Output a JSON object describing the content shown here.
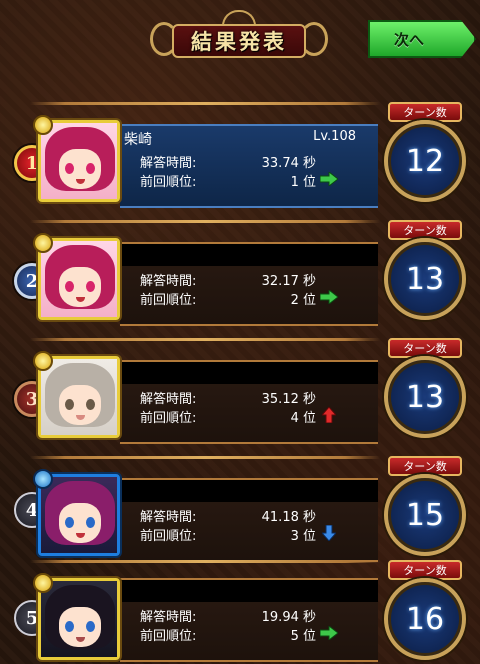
{
  "header": {
    "title": "結果発表",
    "next_label": "次へ"
  },
  "colors": {
    "arrow_up": "#e02a2a",
    "arrow_same": "#3ec84a",
    "arrow_down": "#3a8ae8",
    "highlight_panel": "#1a3a6a",
    "turn_circle": "#0a1a3e"
  },
  "labels": {
    "time": "解答時間:",
    "prev_rank": "前回順位:",
    "turn_count": "ターン数"
  },
  "results": [
    {
      "rank": "1",
      "name": "柴崎",
      "level": "Lv.108",
      "time": "33.74 秒",
      "prev_rank": "1 位",
      "trend": "same",
      "turns": "12",
      "avatar": "pink-hair-girl-avatar"
    },
    {
      "rank": "2",
      "name": "",
      "level": "",
      "time": "32.17 秒",
      "prev_rank": "2 位",
      "trend": "same",
      "turns": "13",
      "avatar": "pink-hair-girl-avatar"
    },
    {
      "rank": "3",
      "name": "",
      "level": "",
      "time": "35.12 秒",
      "prev_rank": "4 位",
      "trend": "up",
      "turns": "13",
      "avatar": "silver-hair-girl-avatar"
    },
    {
      "rank": "4",
      "name": "",
      "level": "",
      "time": "41.18 秒",
      "prev_rank": "3 位",
      "trend": "down",
      "turns": "15",
      "avatar": "magenta-hair-girl-avatar"
    },
    {
      "rank": "5",
      "name": "",
      "level": "",
      "time": "19.94 秒",
      "prev_rank": "5 位",
      "trend": "same",
      "turns": "16",
      "avatar": "dark-hair-warrior-avatar"
    }
  ]
}
